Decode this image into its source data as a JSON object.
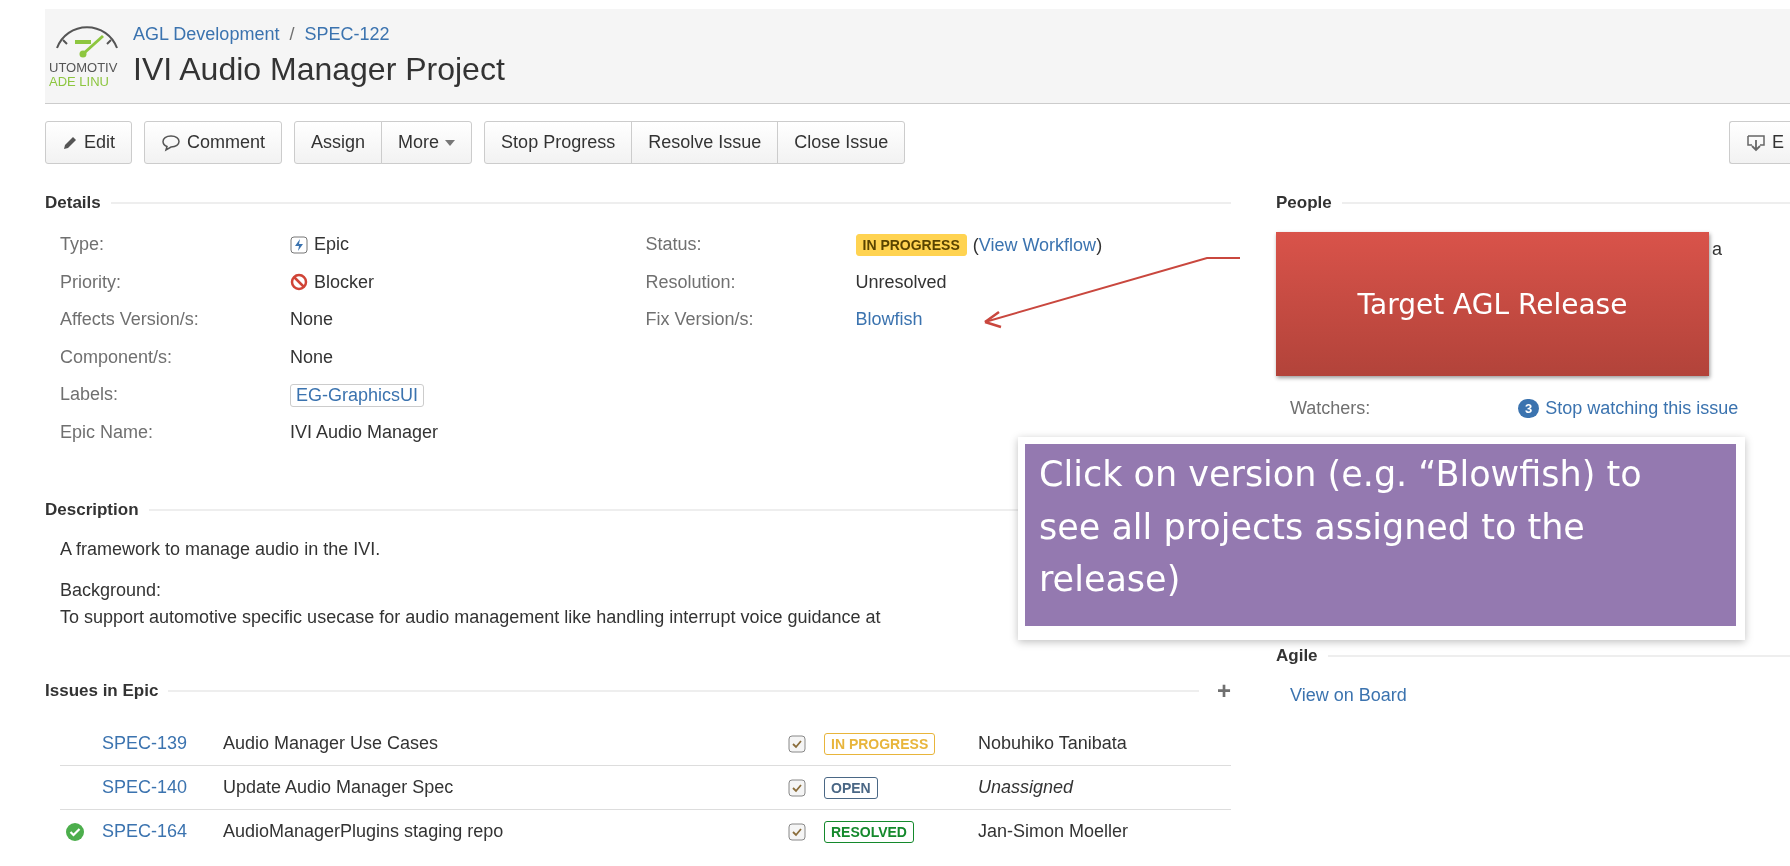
{
  "header": {
    "logo": {
      "lines": [
        "UTOMOTIV",
        "ADE LINU"
      ]
    },
    "breadcrumbs": [
      "AGL Development",
      "SPEC-122"
    ],
    "separator": "/",
    "title": "IVI Audio Manager Project"
  },
  "toolbar": {
    "groups": [
      [
        {
          "label": "Edit",
          "kind": "edit"
        }
      ],
      [
        {
          "label": "Comment",
          "kind": "comment"
        }
      ],
      [
        {
          "label": "Assign",
          "kind": "plain"
        },
        {
          "label": "More",
          "kind": "dropdown"
        }
      ],
      [
        {
          "label": "Stop Progress",
          "kind": "plain"
        },
        {
          "label": "Resolve Issue",
          "kind": "plain"
        },
        {
          "label": "Close Issue",
          "kind": "plain"
        }
      ]
    ],
    "export": {
      "label": "E"
    }
  },
  "details": {
    "heading": "Details",
    "left": [
      {
        "label": "Type:",
        "value": "Epic",
        "kind": "issue-type"
      },
      {
        "label": "Priority:",
        "value": "Blocker",
        "kind": "priority"
      },
      {
        "label": "Affects Version/s:",
        "value": "None",
        "kind": "text"
      },
      {
        "label": "Component/s:",
        "value": "None",
        "kind": "text"
      },
      {
        "label": "Labels:",
        "value": "EG-GraphicsUI",
        "kind": "label"
      },
      {
        "label": "Epic Name:",
        "value": "IVI Audio Manager",
        "kind": "text"
      }
    ],
    "right": [
      {
        "label": "Status:",
        "value": "IN PROGRESS",
        "kind": "status",
        "link": "View Workflow",
        "brackets": [
          "(",
          ")"
        ]
      },
      {
        "label": "Resolution:",
        "value": "Unresolved",
        "kind": "text"
      },
      {
        "label": "Fix Version/s:",
        "value": "Blowfish",
        "kind": "link"
      }
    ]
  },
  "description": {
    "heading": "Description",
    "paragraphs": [
      "A framework to manage audio in the IVI.",
      "Background:",
      "To support automotive specific usecase for audio management like handling interrupt voice guidance at"
    ]
  },
  "issues_in_epic": {
    "heading": "Issues in Epic",
    "add": "+",
    "rows": [
      {
        "key": "SPEC-139",
        "summary": "Audio Manager Use Cases",
        "status": "IN PROGRESS",
        "color": "#e8b53b",
        "assignee": "Nobuhiko Tanibata",
        "unassigned": false,
        "resolved": false
      },
      {
        "key": "SPEC-140",
        "summary": "Update Audio Manager Spec",
        "status": "OPEN",
        "color": "#4a6785",
        "assignee": "Unassigned",
        "unassigned": true,
        "resolved": false
      },
      {
        "key": "SPEC-164",
        "summary": "AudioManagerPlugins staging repo",
        "status": "RESOLVED",
        "color": "#14892c",
        "assignee": "Jan-Simon Moeller",
        "unassigned": false,
        "resolved": true
      }
    ]
  },
  "people": {
    "heading": "People",
    "name_fragment": "a",
    "watchers": {
      "label": "Watchers:",
      "count": "3",
      "link": "Stop watching this issue"
    }
  },
  "agile": {
    "heading": "Agile",
    "link": "View on Board"
  },
  "annotations": [
    {
      "kind": "red",
      "text": "Target AGL Release"
    },
    {
      "kind": "purple",
      "text": "Click on version (e.g. “Blowfish) to see all projects assigned to the release)"
    }
  ]
}
